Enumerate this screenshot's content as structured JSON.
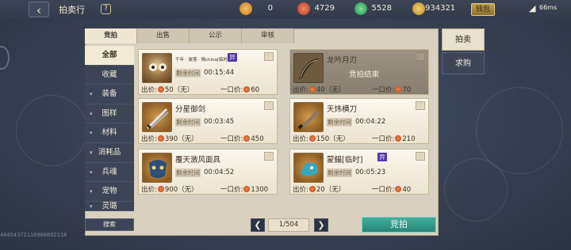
{
  "header": {
    "title": "拍卖行",
    "help_label": "?",
    "back_label": "‹",
    "currencies": [
      {
        "icon": "medal-icon",
        "value": "0",
        "color": "#d38a2e"
      },
      {
        "icon": "red-orb-icon",
        "value": "4729",
        "color": "#c9452b"
      },
      {
        "icon": "green-jade-icon",
        "value": "5528",
        "color": "#2fa35a"
      },
      {
        "icon": "gold-feather-icon",
        "value": "934321",
        "color": "#d9a43a"
      }
    ],
    "wallet_label": "钱包",
    "ping": "66ms"
  },
  "tabs": [
    {
      "label": "竞拍",
      "active": true
    },
    {
      "label": "出售",
      "active": false
    },
    {
      "label": "公示",
      "active": false
    },
    {
      "label": "审核",
      "active": false
    }
  ],
  "categories": [
    {
      "label": "全部",
      "active": true,
      "expandable": false
    },
    {
      "label": "收藏",
      "active": false,
      "expandable": false
    },
    {
      "label": "装备",
      "active": false,
      "expandable": true
    },
    {
      "label": "图样",
      "active": false,
      "expandable": true
    },
    {
      "label": "材料",
      "active": false,
      "expandable": true
    },
    {
      "label": "消耗品",
      "active": false,
      "expandable": true
    },
    {
      "label": "兵魂",
      "active": false,
      "expandable": true
    },
    {
      "label": "宠物",
      "active": false,
      "expandable": true
    },
    {
      "label": "灵璐",
      "active": false,
      "expandable": true
    }
  ],
  "search_label": "搜索",
  "listings": [
    {
      "name": "千年 · 波落 · 情china[临时]",
      "badge": "异",
      "time_label": "剩余时间",
      "time": "00:15:44",
      "bid_prefix": "出价:",
      "bid": "50（无）",
      "buyout_prefix": "一口价:",
      "buyout": "60",
      "ended": false,
      "ended_text": "",
      "icon": "owl-icon"
    },
    {
      "name": "龙吟月刃",
      "badge": "",
      "time_label": "剩余时间",
      "time": "",
      "bid_prefix": "出价:",
      "bid": "40（无）",
      "buyout_prefix": "一口价:",
      "buyout": "70",
      "ended": true,
      "ended_text": "竞拍结束",
      "icon": "crescent-blade-icon"
    },
    {
      "name": "分星御剑",
      "badge": "",
      "time_label": "剩余时间",
      "time": "00:03:45",
      "bid_prefix": "出价:",
      "bid": "390（无）",
      "buyout_prefix": "一口价:",
      "buyout": "450",
      "ended": false,
      "ended_text": "",
      "icon": "sword-icon"
    },
    {
      "name": "天炜横刀",
      "badge": "",
      "time_label": "剩余时间",
      "time": "00:04:22",
      "bid_prefix": "出价:",
      "bid": "150（无）",
      "buyout_prefix": "一口价:",
      "buyout": "210",
      "ended": false,
      "ended_text": "",
      "icon": "broadsword-icon"
    },
    {
      "name": "覆天激风面具",
      "badge": "",
      "time_label": "剩余时间",
      "time": "00:04:52",
      "bid_prefix": "出价:",
      "bid": "900（无）",
      "buyout_prefix": "一口价:",
      "buyout": "1300",
      "ended": false,
      "ended_text": "",
      "icon": "mask-icon"
    },
    {
      "name": "蒙鳎[临时]",
      "badge": "异",
      "time_label": "剩余时间",
      "time": "00:05:23",
      "bid_prefix": "出价:",
      "bid": "20（无）",
      "buyout_prefix": "一口价:",
      "buyout": "40",
      "ended": false,
      "ended_text": "",
      "icon": "beast-icon"
    }
  ],
  "pager": {
    "prev_label": "❮",
    "next_label": "❯",
    "page_text": "1/504"
  },
  "bid_button_label": "竞拍",
  "side_tabs": [
    {
      "label": "拍卖",
      "active": true
    },
    {
      "label": "求购",
      "active": false
    }
  ],
  "trace_id": "46454372110960092118"
}
